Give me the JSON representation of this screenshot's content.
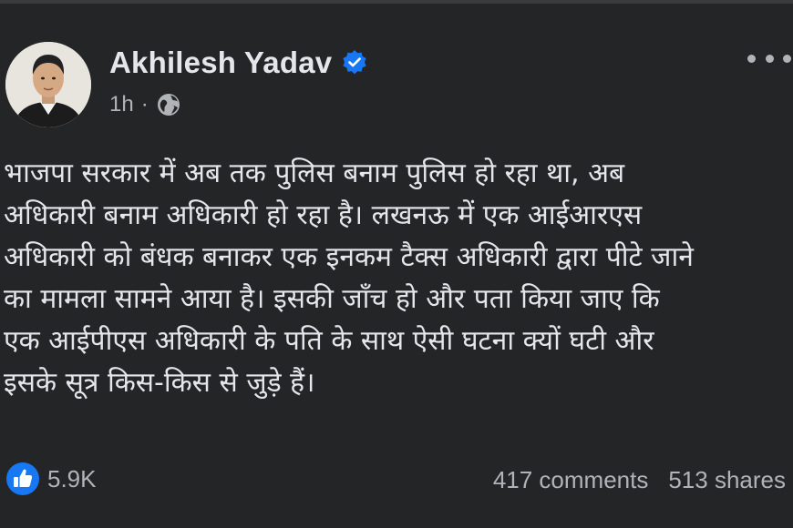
{
  "post": {
    "author": "Akhilesh Yadav",
    "verified": true,
    "time": "1h",
    "separator": "·",
    "audience_icon": "globe-icon",
    "text_lines": [
      "भाजपा सरकार में अब तक पुलिस बनाम पुलिस हो रहा था, अब",
      "अधिकारी बनाम अधिकारी हो रहा है। लखनऊ में एक आईआरएस",
      "अधिकारी को बंधक बनाकर एक इनकम टैक्स अधिकारी द्वारा पीटे जाने",
      "का मामला सामने आया है। इसकी जाँच हो और पता किया जाए कि",
      "एक आईपीएस अधिकारी के पति के साथ ऐसी घटना क्यों घटी और",
      "इसके सूत्र किस-किस से जुड़े हैं।"
    ]
  },
  "stats": {
    "reactions": "5.9K",
    "comments": "417 comments",
    "shares": "513 shares"
  },
  "colors": {
    "background": "#242526",
    "text_primary": "#e4e6eb",
    "text_secondary": "#b0b3b8",
    "accent_blue": "#1877f2"
  }
}
